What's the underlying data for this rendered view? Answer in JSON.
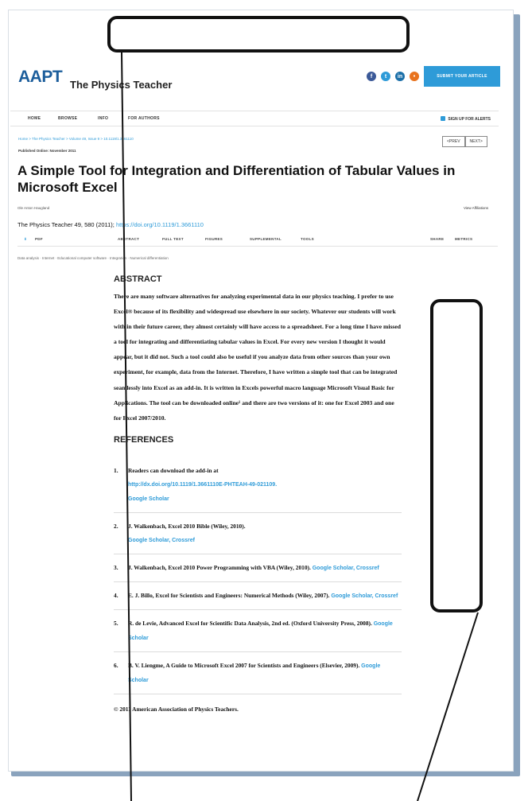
{
  "header": {
    "logo": "AAPT",
    "logo_sub": "",
    "journal_title": "The Physics Teacher",
    "submit_label": "SUBMIT YOUR ARTICLE"
  },
  "nav": {
    "items": [
      "HOME",
      "BROWSE",
      "INFO",
      "FOR AUTHORS"
    ],
    "signup": "SIGN UP FOR ALERTS"
  },
  "breadcrumb": "Home > The Physics Teacher > Volume 49, Issue 9 > 10.1119/1.3661110",
  "published": "Published Online: November 2011",
  "pager": {
    "prev": "<PREV",
    "next": "NEXT>"
  },
  "article": {
    "title": "A Simple Tool for Integration and Differentiation of Tabular Values in Microsoft Excel",
    "author": "Ole Anton Haugland",
    "affiliations": "View Affiliations",
    "citation_prefix": "The Physics Teacher 49, 580 (2011); ",
    "doi": "https://doi.org/10.1119/1.3661110"
  },
  "tabs": {
    "pdf": "PDF",
    "items": [
      "ABSTRACT",
      "FULL TEXT",
      "FIGURES",
      "SUPPLEMENTAL",
      "TOOLS"
    ],
    "right": [
      "SHARE",
      "METRICS"
    ]
  },
  "keywords": "Data analysis  ·  Internet  ·  Educational computer software  ·  Integration  ·  Numerical differentiation",
  "abstract": {
    "heading": "ABSTRACT",
    "text": "There are many software alternatives for analyzing experimental data in our physics teaching. I prefer to use Excel® because of its flexibility and widespread use elsewhere in our society. Whatever our students will work with in their future career, they almost certainly will have access to a spreadsheet. For a long time I have missed a tool for integrating and differentiating tabular values in Excel. For every new version I thought it would appear, but it did not. Such a tool could also be useful if you analyze data from other sources than your own experiment, for example, data from the Internet. Therefore, I have written a simple tool that can be integrated seamlessly into Excel as an add-in. It is written in Excels powerful macro language Microsoft Visual Basic for Applications. The tool can be downloaded online¹ and there are two versions of it: one for Excel 2003 and one for Excel 2007/2010."
  },
  "references": {
    "heading": "REFERENCES",
    "items": [
      {
        "num": "1.",
        "text": "Readers can download the add-in at",
        "link": "http://dx.doi.org/10.1119/1.3661110E-PHTEAH-49-021109.",
        "scholar": "Google Scholar",
        "crossref": ""
      },
      {
        "num": "2.",
        "text": "J. Walkenbach, Excel 2010 Bible (Wiley, 2010).",
        "link": "",
        "scholar": "Google Scholar,",
        "crossref": "Crossref"
      },
      {
        "num": "3.",
        "text": "J. Walkenbach, Excel 2010 Power Programming with VBA (Wiley, 2010).",
        "link": "",
        "scholar": "Google Scholar,",
        "crossref": "Crossref"
      },
      {
        "num": "4.",
        "text": "E. J. Billo, Excel for Scientists and Engineers: Numerical Methods (Wiley, 2007).",
        "link": "",
        "scholar": "Google Scholar,",
        "crossref": "Crossref"
      },
      {
        "num": "5.",
        "text": "R. de Levie, Advanced Excel for Scientific Data Analysis, 2nd ed. (Oxford University Press, 2008).",
        "link": "",
        "scholar": "Google Scholar",
        "crossref": ""
      },
      {
        "num": "6.",
        "text": "B. V. Liengme, A Guide to Microsoft Excel 2007 for Scientists and Engineers (Elsevier, 2009).",
        "link": "",
        "scholar": "Google Scholar",
        "crossref": ""
      }
    ]
  },
  "copyright": "© 2011 American Association of Physics Teachers.",
  "colors": {
    "accent": "#2e9bd8",
    "logo": "#1b5d9b",
    "shadow": "#8aa3bd"
  }
}
